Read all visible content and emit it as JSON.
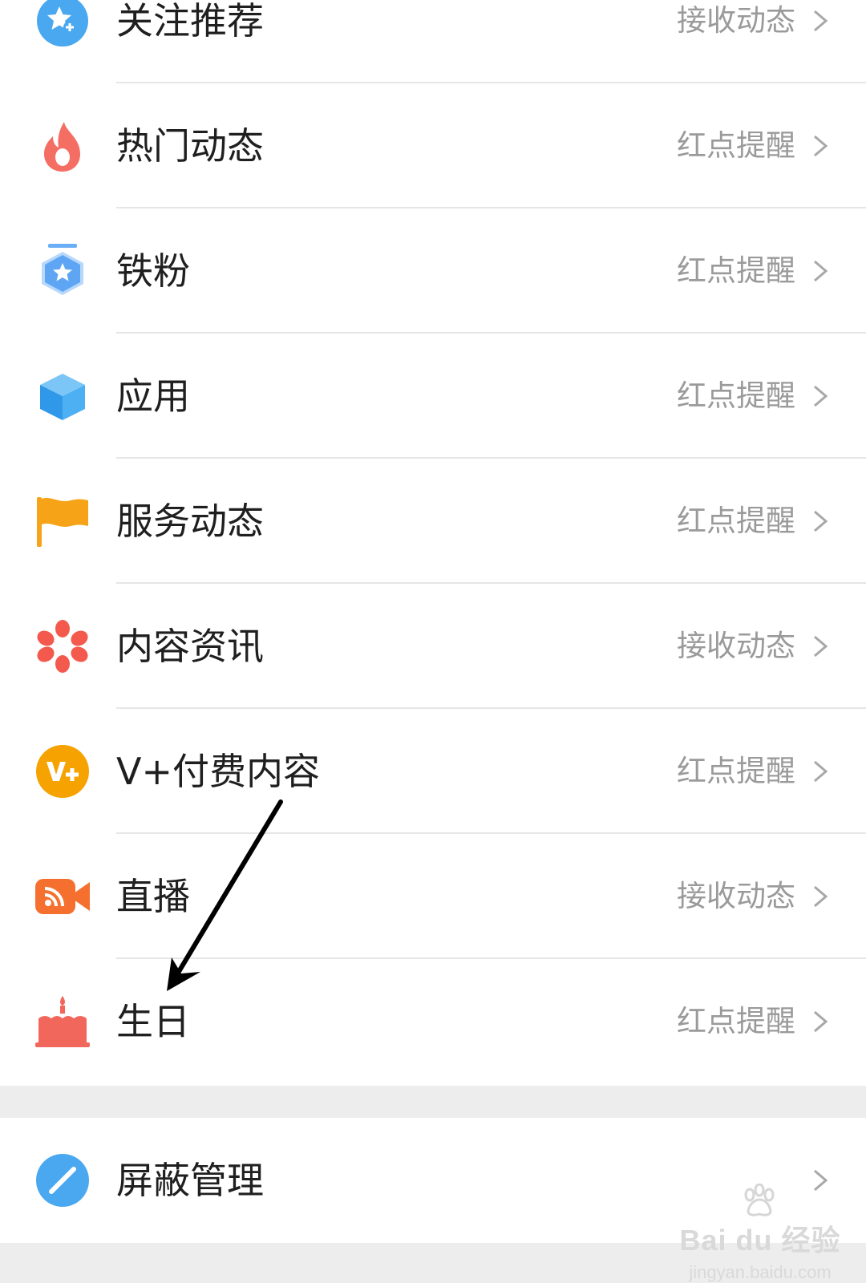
{
  "settings": {
    "items": [
      {
        "label": "关注推荐",
        "value": "接收动态",
        "icon": "star-plus-icon",
        "color": "#4aa8f0"
      },
      {
        "label": "热门动态",
        "value": "红点提醒",
        "icon": "flame-icon",
        "color": "#f46e63"
      },
      {
        "label": "铁粉",
        "value": "红点提醒",
        "icon": "star-badge-icon",
        "color": "#6aaef5"
      },
      {
        "label": "应用",
        "value": "红点提醒",
        "icon": "cube-icon",
        "color": "#3aa3ee"
      },
      {
        "label": "服务动态",
        "value": "红点提醒",
        "icon": "flag-icon",
        "color": "#f6a317"
      },
      {
        "label": "内容资讯",
        "value": "接收动态",
        "icon": "flower-icon",
        "color": "#f35a4d"
      },
      {
        "label": "V+付费内容",
        "value": "红点提醒",
        "icon": "v-plus-icon",
        "color": "#f6a200"
      },
      {
        "label": "直播",
        "value": "接收动态",
        "icon": "live-camera-icon",
        "color": "#f5702f"
      },
      {
        "label": "生日",
        "value": "红点提醒",
        "icon": "cake-icon",
        "color": "#f2675c"
      }
    ],
    "block_item": {
      "label": "屏蔽管理",
      "value": "",
      "icon": "block-icon",
      "color": "#4aa8f0"
    }
  },
  "watermark": {
    "logo_text": "Bai du 经验",
    "url": "jingyan.baidu.com"
  },
  "colors": {
    "background": "#ededed",
    "label": "#1f1f1f",
    "value": "#9a9a9a",
    "divider": "#e6e6e6"
  }
}
